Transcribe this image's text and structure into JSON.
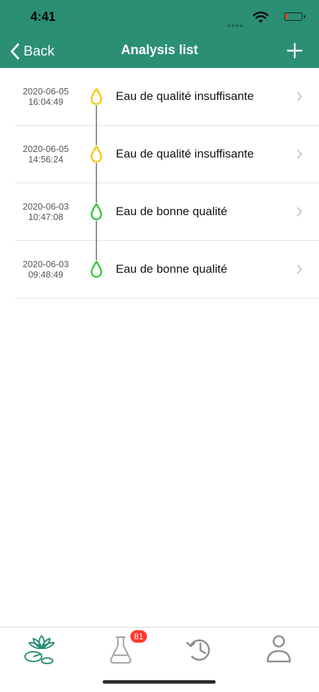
{
  "status_bar": {
    "time": "4:41"
  },
  "nav": {
    "back_label": "Back",
    "title": "Analysis list",
    "add_icon": "plus-icon"
  },
  "colors": {
    "header": "#2b8f73",
    "drop_warning": "#f5c800",
    "drop_good": "#2fc53a",
    "badge": "#ff3b30"
  },
  "analyses": [
    {
      "date": "2020-06-05",
      "time": "16:04:49",
      "title": "Eau de qualité insuffisante",
      "status": "warning"
    },
    {
      "date": "2020-06-05",
      "time": "14:56:24",
      "title": "Eau de qualité insuffisante",
      "status": "warning"
    },
    {
      "date": "2020-06-03",
      "time": "10:47:08",
      "title": "Eau de bonne qualité",
      "status": "good"
    },
    {
      "date": "2020-06-03",
      "time": "09:48:49",
      "title": "Eau de bonne qualité",
      "status": "good"
    }
  ],
  "tabbar": {
    "tabs": [
      {
        "icon": "lotus-icon",
        "active": true
      },
      {
        "icon": "flask-icon",
        "badge": "81"
      },
      {
        "icon": "history-icon"
      },
      {
        "icon": "profile-icon"
      }
    ]
  }
}
